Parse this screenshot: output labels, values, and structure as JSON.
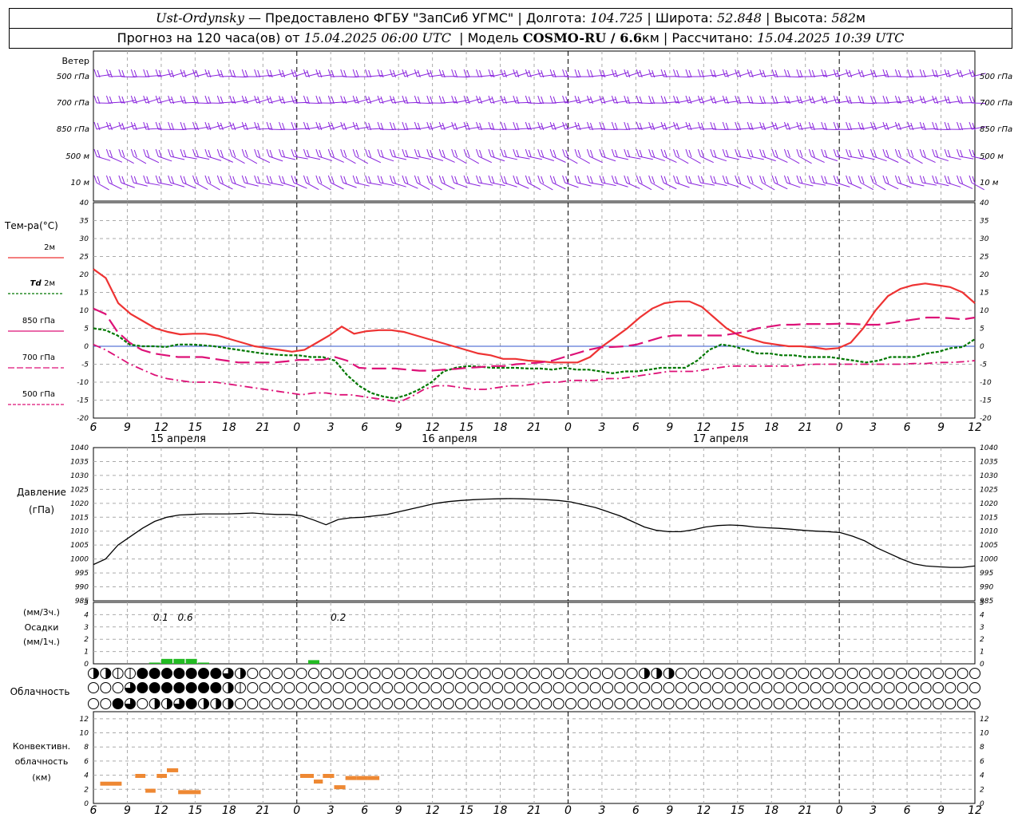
{
  "header": {
    "station": "Ust-Ordynsky",
    "provider": "— Предоставлено ФГБУ \"ЗапСиб УГМС\"",
    "lon_label": "Долгота:",
    "lon": "104.725",
    "lat_label": "Широта:",
    "lat": "52.848",
    "alt_label": "Высота:",
    "alt": "582",
    "alt_unit": "м",
    "forecast_label": "Прогноз на 120 часа(ов) от",
    "forecast_start": "15.04.2025 06:00 UTC",
    "model_label": "Модель",
    "model": "COSMO-RU / 6.6",
    "model_unit": "км",
    "calc_label": "Рассчитано:",
    "calc_time": "15.04.2025 10:39 UTC"
  },
  "chart_data": {
    "type": "line",
    "x_hour_ticks": [
      "6",
      "9",
      "12",
      "15",
      "18",
      "21",
      "0",
      "3",
      "6",
      "9",
      "12",
      "15",
      "18",
      "21",
      "0",
      "3",
      "6",
      "9",
      "12",
      "15",
      "18",
      "21",
      "0",
      "3",
      "6",
      "9",
      "12"
    ],
    "date_labels": [
      {
        "label": "15 апреля",
        "at_step": 2.5
      },
      {
        "label": "16 апреля",
        "at_step": 10.5
      },
      {
        "label": "17 апреля",
        "at_step": 18.5
      }
    ],
    "day_boundaries": [
      6,
      14,
      22
    ],
    "wind": {
      "title": "Ветер",
      "levels": [
        "500 гПа",
        "700 гПа",
        "850 гПа",
        "500 м",
        "10 м"
      ]
    },
    "temperature": {
      "title": "Тем-ра(°C)",
      "ylim": [
        -20,
        40
      ],
      "yticks": [
        "40",
        "35",
        "30",
        "25",
        "20",
        "15",
        "10",
        "5",
        "0",
        "-5",
        "-10",
        "-15",
        "-20"
      ],
      "series": [
        {
          "name": "2м",
          "color": "#ee3333",
          "dash": "",
          "width": 2.2,
          "values": [
            21.5,
            19,
            12,
            9,
            7,
            5,
            4,
            3.3,
            3.5,
            3.5,
            3,
            2,
            1,
            0,
            -0.5,
            -1,
            -1.5,
            -1,
            1,
            3,
            5.5,
            3.5,
            4.2,
            4.5,
            4.5,
            4,
            3,
            2,
            1,
            0,
            -1,
            -2,
            -2.5,
            -3.5,
            -3.5,
            -4,
            -4.2,
            -4.5,
            -4.5,
            -4.5,
            -3,
            0,
            2.5,
            5,
            8,
            10.5,
            12,
            12.5,
            12.5,
            11,
            8,
            5,
            3,
            2,
            1,
            0.5,
            0,
            0,
            -0.3,
            -0.8,
            -0.5,
            1,
            5,
            10,
            14,
            16,
            17,
            17.5,
            17,
            16.5,
            15,
            12
          ]
        },
        {
          "name": "Td 2м",
          "color": "#007700",
          "dash": "4 2",
          "width": 2.2,
          "values": [
            5,
            4.5,
            3,
            0.5,
            0,
            0,
            -0.2,
            0.5,
            0.5,
            0.3,
            0,
            -0.5,
            -1,
            -1.5,
            -2,
            -2.3,
            -2.5,
            -2.5,
            -3,
            -3,
            -4,
            -8,
            -11,
            -13,
            -14,
            -14.5,
            -13.5,
            -12,
            -10,
            -7,
            -6,
            -5.5,
            -5.7,
            -6,
            -6,
            -6,
            -6.2,
            -6.2,
            -6.5,
            -6,
            -6.5,
            -6.5,
            -7,
            -7.5,
            -7,
            -7,
            -6.5,
            -6,
            -6,
            -6,
            -4,
            -1,
            0.5,
            0,
            -1,
            -2,
            -2,
            -2.5,
            -2.5,
            -3,
            -3,
            -3,
            -3.5,
            -4,
            -4.5,
            -4,
            -3,
            -3,
            -3,
            -2,
            -1.5,
            -0.5,
            -0.2,
            2
          ]
        },
        {
          "name": "850 гПа",
          "color": "#dd1177",
          "dash": "18 7",
          "width": 2.2,
          "values": [
            10.5,
            9,
            4,
            1,
            -1,
            -2,
            -2.5,
            -3,
            -3,
            -3,
            -3.5,
            -4,
            -4.5,
            -4.5,
            -4.5,
            -4.5,
            -4.2,
            -3.8,
            -3.8,
            -3.8,
            -3,
            -4,
            -6,
            -6.2,
            -6.2,
            -6.2,
            -6.5,
            -6.8,
            -6.8,
            -6.5,
            -6.3,
            -6,
            -5.8,
            -5.5,
            -5.5,
            -5,
            -4.8,
            -4.5,
            -4,
            -3,
            -2,
            -1,
            -0.3,
            -0.2,
            0,
            0.5,
            1.5,
            2.5,
            3,
            3,
            3,
            3,
            3,
            3.5,
            4,
            5,
            5.5,
            6,
            6,
            6.2,
            6.2,
            6.2,
            6.3,
            6.2,
            6,
            6,
            6.5,
            7,
            7.5,
            8,
            8,
            7.8,
            7.5,
            8
          ]
        },
        {
          "name": "700 гПа",
          "color": "#dd1177",
          "dash": "10 4 2 4",
          "width": 1.8,
          "values": [
            0.5,
            -1,
            -3,
            -5,
            -6.5,
            -8,
            -9,
            -9.5,
            -10,
            -10,
            -10,
            -10.5,
            -11,
            -11.5,
            -12,
            -12.5,
            -13,
            -13.5,
            -13,
            -13,
            -13.5,
            -13.5,
            -14,
            -14.5,
            -15,
            -15.5,
            -14,
            -12,
            -11,
            -11,
            -11.5,
            -12,
            -12,
            -11.5,
            -11,
            -11,
            -10.5,
            -10,
            -10,
            -9.5,
            -9.5,
            -9.5,
            -9,
            -9,
            -8.5,
            -8,
            -7.5,
            -7,
            -7,
            -7,
            -6.5,
            -6,
            -5.5,
            -5.5,
            -5.5,
            -5.5,
            -5.5,
            -5.5,
            -5.2,
            -5,
            -5,
            -5,
            -5,
            -5,
            -5,
            -5,
            -5,
            -4.8,
            -4.8,
            -4.5,
            -4.5,
            -4.3,
            -4
          ]
        }
      ],
      "legend": [
        {
          "label": "2м",
          "italic_prefix": "",
          "color": "#ee3333",
          "dash": ""
        },
        {
          "label": "2м",
          "italic_prefix": "Td",
          "color": "#007700",
          "dash": "3 2"
        },
        {
          "label": "850 гПа",
          "italic_prefix": "",
          "color": "#dd1177",
          "dash": ""
        },
        {
          "label": "700 гПа",
          "italic_prefix": "",
          "color": "#dd1177",
          "dash": "8 3"
        },
        {
          "label": "500 гПа",
          "italic_prefix": "",
          "color": "#dd1177",
          "dash": "4 2"
        }
      ]
    },
    "pressure": {
      "title_line1": "Давление",
      "title_line2": "(гПа)",
      "ylim": [
        985,
        1040
      ],
      "yticks": [
        "1040",
        "1035",
        "1030",
        "1025",
        "1020",
        "1015",
        "1010",
        "1005",
        "1000",
        "995",
        "990",
        "985"
      ],
      "values": [
        998,
        1000,
        1005,
        1008,
        1011,
        1013.5,
        1015,
        1015.8,
        1016,
        1016.2,
        1016.2,
        1016.2,
        1016.3,
        1016.5,
        1016.2,
        1016,
        1016,
        1015.5,
        1014,
        1012.3,
        1014.2,
        1014.8,
        1015,
        1015.5,
        1016,
        1017,
        1018,
        1019,
        1020,
        1020.6,
        1021,
        1021.3,
        1021.5,
        1021.6,
        1021.7,
        1021.6,
        1021.5,
        1021.3,
        1021,
        1020.5,
        1019.5,
        1018.5,
        1017,
        1015.5,
        1013.5,
        1011.5,
        1010.3,
        1009.8,
        1009.8,
        1010.5,
        1011.5,
        1012,
        1012.2,
        1012,
        1011.5,
        1011.2,
        1011,
        1010.7,
        1010.3,
        1010,
        1009.8,
        1009.5,
        1008.2,
        1006.5,
        1004,
        1002,
        1000,
        998.3,
        997.5,
        997.2,
        997,
        997,
        997.5
      ]
    },
    "precipitation": {
      "title_line1": "(мм/3ч.)",
      "title_line2": "Осадки",
      "title_line3": "(мм/1ч.)",
      "ylim": [
        0,
        5
      ],
      "yticks": [
        "5",
        "4",
        "3",
        "2",
        "1",
        "0"
      ],
      "labels": [
        {
          "text": "0.1",
          "at_step": 4.2
        },
        {
          "text": "0.6",
          "at_step": 6.2
        },
        {
          "text": "0.2",
          "at_step": 18.7
        }
      ],
      "bars": [
        {
          "step": 5,
          "value": 0.1
        },
        {
          "step": 6,
          "value": 0.4
        },
        {
          "step": 7,
          "value": 0.4
        },
        {
          "step": 8,
          "value": 0.4
        },
        {
          "step": 9,
          "value": 0.1
        },
        {
          "step": 18,
          "value": 0.3
        }
      ]
    },
    "cloudiness": {
      "title": "Облачность",
      "low": [
        2,
        2,
        1,
        1,
        4,
        4,
        4,
        4,
        4,
        4,
        4,
        3,
        2,
        0,
        0,
        0,
        0,
        0,
        0,
        0,
        0,
        0,
        0,
        0,
        0,
        0,
        0,
        0,
        0,
        0,
        0,
        0,
        0,
        0,
        0,
        0,
        0,
        0,
        0,
        0,
        0,
        0,
        0,
        0,
        0,
        2,
        2,
        2,
        0,
        0,
        0,
        0,
        0,
        0,
        0,
        0,
        0,
        0,
        0,
        0,
        0,
        0,
        0,
        0,
        0,
        0,
        0,
        0,
        0,
        0,
        0,
        0,
        0,
        0,
        0,
        0,
        0,
        0,
        0,
        0,
        0,
        0,
        0,
        0,
        0,
        0,
        0,
        0,
        0,
        0,
        0,
        0,
        0,
        0,
        0,
        0,
        0,
        0,
        0,
        0,
        0,
        0,
        0,
        0,
        0,
        0,
        0,
        0,
        0,
        0,
        0,
        0,
        0,
        0,
        0,
        0,
        0,
        0,
        0,
        0,
        0,
        0,
        0,
        0,
        0,
        0,
        0,
        0,
        0,
        0,
        0,
        0,
        0,
        0,
        0,
        0,
        0,
        0,
        0,
        0,
        0,
        0,
        0,
        0,
        0,
        0,
        0,
        0,
        0,
        0,
        0,
        0,
        0,
        0,
        0,
        0,
        0,
        0,
        0,
        0,
        0
      ],
      "mid": [
        0,
        0,
        0,
        3,
        4,
        4,
        4,
        4,
        4,
        4,
        4,
        2,
        1,
        0,
        0,
        0,
        0,
        0,
        0,
        0,
        0,
        0,
        0,
        0,
        0,
        0,
        0,
        0,
        0,
        0,
        0,
        0,
        0,
        0,
        0,
        0,
        0,
        0,
        0,
        0,
        0,
        0,
        0,
        0,
        0,
        0,
        0,
        0,
        0,
        0,
        0,
        0,
        0,
        0,
        0,
        0,
        0,
        0,
        0,
        0,
        0,
        0,
        0,
        0,
        0,
        0,
        0,
        0,
        0,
        0,
        0,
        0,
        0,
        0,
        0,
        0,
        0,
        0,
        0,
        0,
        0,
        0,
        0,
        0,
        0,
        0,
        0,
        0,
        0,
        0,
        0,
        0,
        0,
        0,
        0,
        0,
        0,
        0,
        0,
        0,
        0,
        0,
        0,
        0,
        0,
        0,
        0,
        0,
        0,
        0,
        0,
        0,
        0,
        0,
        0,
        0,
        0,
        0,
        0,
        0,
        0,
        0,
        0,
        0,
        0,
        0,
        0,
        0,
        0,
        0,
        0,
        0,
        0,
        0,
        0,
        0,
        0,
        0,
        0,
        0,
        0,
        0,
        0,
        0,
        0,
        0,
        0,
        0,
        0,
        0,
        0,
        0,
        0,
        0,
        0,
        0,
        0,
        0,
        0,
        0,
        0
      ],
      "high": [
        0,
        0,
        4,
        3,
        0,
        2,
        2,
        3,
        4,
        2,
        2,
        2,
        0,
        0,
        0,
        0,
        0,
        0,
        0,
        0,
        0,
        0,
        0,
        0,
        0,
        0,
        0,
        0,
        0,
        0,
        0,
        0,
        0,
        0,
        0,
        0,
        0,
        0,
        0,
        0,
        0,
        0,
        0,
        0,
        0,
        0,
        0,
        0,
        0,
        0,
        0,
        0,
        0,
        0,
        0,
        0,
        0,
        0,
        0,
        0,
        0,
        0,
        0,
        0,
        0,
        0,
        0,
        0,
        0,
        0,
        0,
        0,
        0,
        0,
        0,
        0,
        0,
        0,
        0,
        0,
        0,
        0,
        0,
        0,
        0,
        0,
        0,
        0,
        0,
        0,
        0,
        0,
        0,
        0,
        0,
        0,
        0,
        0,
        0,
        0,
        0,
        0,
        0,
        0,
        0,
        0,
        0,
        0,
        0,
        0,
        0,
        0,
        0,
        0,
        0,
        0,
        0,
        0,
        0,
        0,
        0,
        0,
        0,
        0,
        0,
        0,
        0,
        0,
        0,
        0,
        0,
        0,
        0,
        0,
        0,
        0,
        0,
        0,
        0,
        0,
        0,
        0,
        0,
        0,
        0,
        0,
        0,
        0,
        0,
        0,
        0,
        0,
        0,
        0,
        0,
        0,
        0,
        0,
        0,
        0,
        0
      ]
    },
    "convective": {
      "title_line1": "Конвективн.",
      "title_line2": "облачность",
      "title_line3": "(км)",
      "ylim": [
        0,
        13
      ],
      "yticks": [
        "12",
        "10",
        "8",
        "6",
        "4",
        "2",
        "0"
      ],
      "segments": [
        {
          "x0": 0.6,
          "x1": 2.5,
          "y": 2.8
        },
        {
          "x0": 3.7,
          "x1": 4.6,
          "y": 3.9
        },
        {
          "x0": 4.6,
          "x1": 5.5,
          "y": 1.8
        },
        {
          "x0": 5.6,
          "x1": 6.5,
          "y": 3.9
        },
        {
          "x0": 6.5,
          "x1": 7.5,
          "y": 4.7
        },
        {
          "x0": 7.5,
          "x1": 9.5,
          "y": 1.6
        },
        {
          "x0": 18.3,
          "x1": 19.5,
          "y": 3.9
        },
        {
          "x0": 19.5,
          "x1": 20.3,
          "y": 3.1
        },
        {
          "x0": 20.3,
          "x1": 21.3,
          "y": 3.9
        },
        {
          "x0": 21.3,
          "x1": 22.3,
          "y": 2.3
        },
        {
          "x0": 22.3,
          "x1": 23.3,
          "y": 3.6
        },
        {
          "x0": 23.3,
          "x1": 24.3,
          "y": 3.6
        },
        {
          "x0": 24.3,
          "x1": 25.3,
          "y": 3.6
        }
      ]
    }
  }
}
